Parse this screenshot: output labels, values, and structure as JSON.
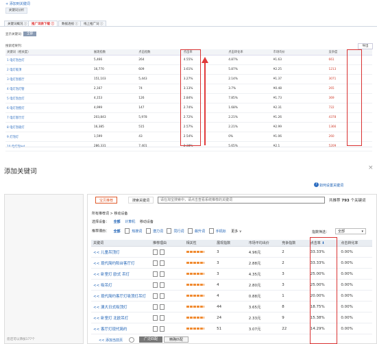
{
  "top": {
    "add_link": "+ 添加到关键词",
    "toolbar_chip": "关键词分析",
    "tabs": [
      {
        "label": "关键词概况 ⓘ",
        "active": false
      },
      {
        "label": "推广词表下载 ⓘ",
        "active": true
      },
      {
        "label": "数据透视 ⓘ",
        "active": false
      },
      {
        "label": "线上推广词 ⓘ",
        "active": false
      }
    ],
    "filter_label": "显示关键词：",
    "filter_button": "全部",
    "result_label": "搜索结果列：",
    "export_button": "导出",
    "table": {
      "headers": [
        "关键词（相关度）",
        "展现指数",
        "点击指数",
        "点击率",
        "点击转化率",
        "市场均价",
        "竞争度"
      ],
      "rows": [
        [
          "1  电灯泡台灯",
          "5,466",
          "264",
          "4.55%",
          "4.87%",
          "¥1.63",
          "661"
        ],
        [
          "2  电灯吸顶",
          "16,770",
          "609",
          "3.61%",
          "5.87%",
          "¥2.25",
          "1213"
        ],
        [
          "3  电灯泡客厅",
          "151,103",
          "5,443",
          "3.27%",
          "2.14%",
          "¥1.37",
          "3071"
        ],
        [
          "4  电灯泡灯管",
          "2,167",
          "74",
          "3.13%",
          "3.7%",
          "¥0.48",
          "265"
        ],
        [
          "5  电灯泡台灯",
          "4,153",
          "126",
          "2.84%",
          "7.85%",
          "¥1.73",
          "369"
        ],
        [
          "6  电灯泡壁灯",
          "4,999",
          "147",
          "2.74%",
          "1.68%",
          "¥2.31",
          "722"
        ],
        [
          "7  电灯客厅灯",
          "203,843",
          "5,978",
          "2.72%",
          "2.21%",
          "¥1.26",
          "4378"
        ],
        [
          "8  电灯泡吸灯",
          "16,385",
          "515",
          "2.57%",
          "2.21%",
          "¥2.99",
          "1366"
        ],
        [
          "9  灯泡灯",
          "1,599",
          "43",
          "2.54%",
          "0%",
          "¥1.06",
          "260"
        ],
        [
          "10  电灯泡led",
          "286,331",
          "7,401",
          "2.38%",
          "5.65%",
          "¥2.1",
          "5209"
        ]
      ]
    }
  },
  "dialog": {
    "title": "添加关键词",
    "close": "×",
    "help": "如何设置关键词",
    "help_icon": "?",
    "left_count": "您还可以添加177个",
    "tabs": [
      {
        "label": "宝贝推荐",
        "active": true
      },
      {
        "label": "搜索关键词",
        "active": false
      }
    ],
    "search_placeholder": "请在淘宝搜索中，请点击查看系统推荐的关键词",
    "total_prefix": "共推荐",
    "total_count": "793",
    "total_suffix": "个关键词",
    "breadcrumb": "所有推荐词 > 移动设备",
    "device_label": "选择设备：",
    "devices": [
      "全部",
      "计算机",
      "移动设备"
    ],
    "reason_label": "推荐理由：",
    "reasons": [
      "全部",
      "热搜词",
      "潜力词",
      "同行词",
      "飙升词",
      "手机标"
    ],
    "more": "更多 ∨",
    "sort_label": "指数筛选：",
    "sort_value": "全部",
    "headers": [
      "关键词",
      "推荐理由",
      "相关性",
      "展现指数",
      "市场平均出价",
      "竞争指数",
      "点击率",
      "点击转化率"
    ],
    "rows": [
      {
        "kw": "<< 儿童吊顶灯",
        "impr": "3",
        "price": "4.96元",
        "comp": "2",
        "ctr": "33.33%",
        "cvr": "0.00%"
      },
      {
        "kw": "<< 现代简约阳台客厅灯",
        "impr": "3",
        "price": "2.88元",
        "comp": "2",
        "ctr": "33.33%",
        "cvr": "0.00%"
      },
      {
        "kw": "<< 卧室灯 欧式 吊灯",
        "impr": "3",
        "price": "4.35元",
        "comp": "3",
        "ctr": "25.00%",
        "cvr": "0.00%"
      },
      {
        "kw": "<< 吸吊灯",
        "impr": "4",
        "price": "2.80元",
        "comp": "3",
        "ctr": "25.00%",
        "cvr": "0.00%"
      },
      {
        "kw": "<< 现代简约客厅灯吸顶灯吊灯",
        "impr": "4",
        "price": "0.88元",
        "comp": "1",
        "ctr": "20.00%",
        "cvr": "0.00%"
      },
      {
        "kw": "<< 澳大日式吸顶灯",
        "impr": "44",
        "price": "3.65元",
        "comp": "8",
        "ctr": "18.75%",
        "cvr": "0.00%"
      },
      {
        "kw": "<< 卧室灯 北欧吊灯",
        "impr": "24",
        "price": "2.33元",
        "comp": "9",
        "ctr": "15.38%",
        "cvr": "0.00%"
      },
      {
        "kw": "<< 客厅灯现代简约",
        "impr": "51",
        "price": "3.07元",
        "comp": "22",
        "ctr": "14.29%",
        "cvr": "0.00%"
      }
    ],
    "add_page": "<< 添加当前页",
    "smart_match": "广泛匹配",
    "precise_match": "精确匹配"
  }
}
